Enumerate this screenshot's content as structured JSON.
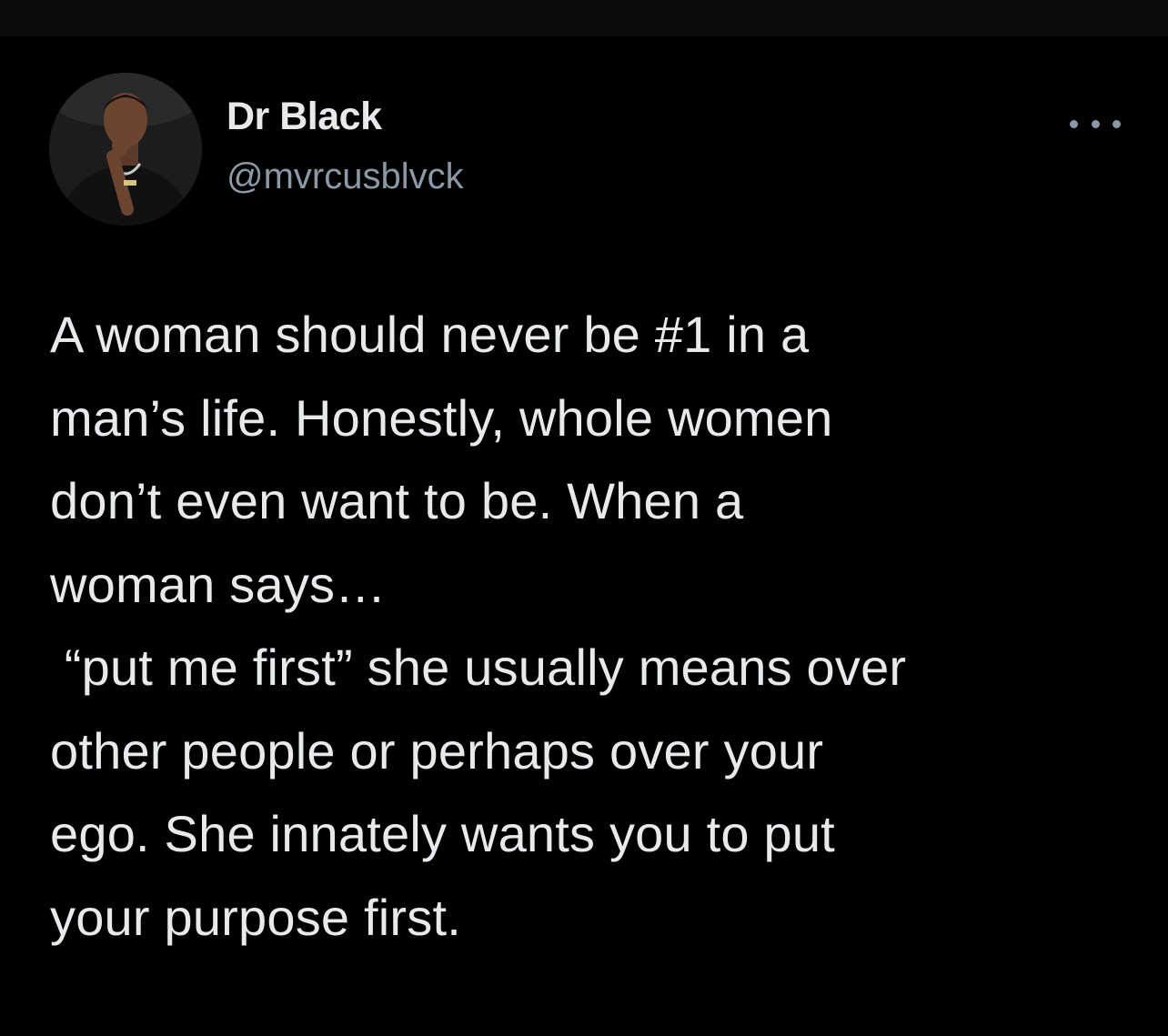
{
  "tweet": {
    "author": {
      "display_name": "Dr Black",
      "handle": "@mvrcusblvck",
      "avatar_icon": "profile-photo"
    },
    "more_icon": "more-horizontal-icon",
    "text_lines": [
      "A woman should never be #1 in a",
      "man’s life. Honestly, whole women",
      "don’t even want to be. When a",
      "woman says…",
      " “put me first” she usually means over",
      "other people or perhaps over your",
      "ego. She innately wants you to put",
      "your purpose first."
    ]
  },
  "colors": {
    "background": "#000000",
    "top_strip": "#0b0b0b",
    "primary_text": "#e7e9ea",
    "secondary_text": "#8b98a5"
  }
}
